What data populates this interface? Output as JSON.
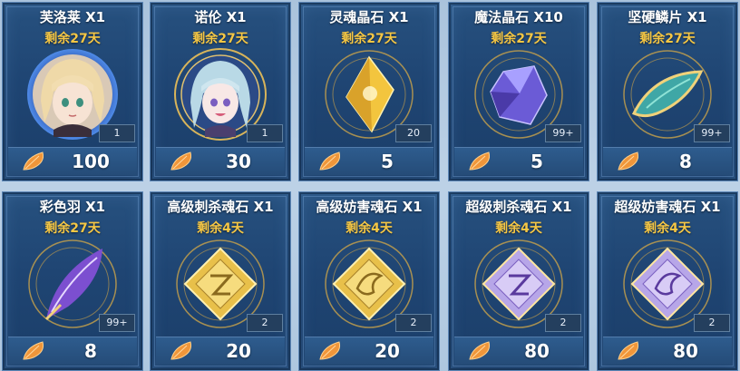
{
  "shop": {
    "currency_icon": "orange-feather-coin-icon",
    "items": [
      {
        "name": "芙洛莱 X1",
        "remain": "剩余27天",
        "qty": "1",
        "price": "100",
        "icon": "heroine-portrait-blonde-icon"
      },
      {
        "name": "诺伦 X1",
        "remain": "剩余27天",
        "qty": "1",
        "price": "30",
        "icon": "heroine-portrait-silver-hair-icon"
      },
      {
        "name": "灵魂晶石 X1",
        "remain": "剩余27天",
        "qty": "20",
        "price": "5",
        "icon": "golden-soul-crystal-icon"
      },
      {
        "name": "魔法晶石 X10",
        "remain": "剩余27天",
        "qty": "99+",
        "price": "5",
        "icon": "purple-magic-crystal-icon"
      },
      {
        "name": "坚硬鳞片 X1",
        "remain": "剩余27天",
        "qty": "99+",
        "price": "8",
        "icon": "hard-scale-icon"
      },
      {
        "name": "彩色羽 X1",
        "remain": "剩余27天",
        "qty": "99+",
        "price": "8",
        "icon": "rainbow-feather-icon"
      },
      {
        "name": "高级刺杀魂石 X1",
        "remain": "剩余4天",
        "qty": "2",
        "price": "20",
        "icon": "gold-assassin-soulstone-icon"
      },
      {
        "name": "高级妨害魂石 X1",
        "remain": "剩余4天",
        "qty": "2",
        "price": "20",
        "icon": "gold-hinder-soulstone-icon"
      },
      {
        "name": "超级刺杀魂石 X1",
        "remain": "剩余4天",
        "qty": "2",
        "price": "80",
        "icon": "purple-assassin-soulstone-icon"
      },
      {
        "name": "超级妨害魂石 X1",
        "remain": "剩余4天",
        "qty": "2",
        "price": "80",
        "icon": "purple-hinder-soulstone-icon"
      }
    ]
  },
  "colors": {
    "card_bg": "#1f4573",
    "remain_text": "#f6c744",
    "gold": "#e8c04a",
    "purple": "#8a6fe0"
  }
}
